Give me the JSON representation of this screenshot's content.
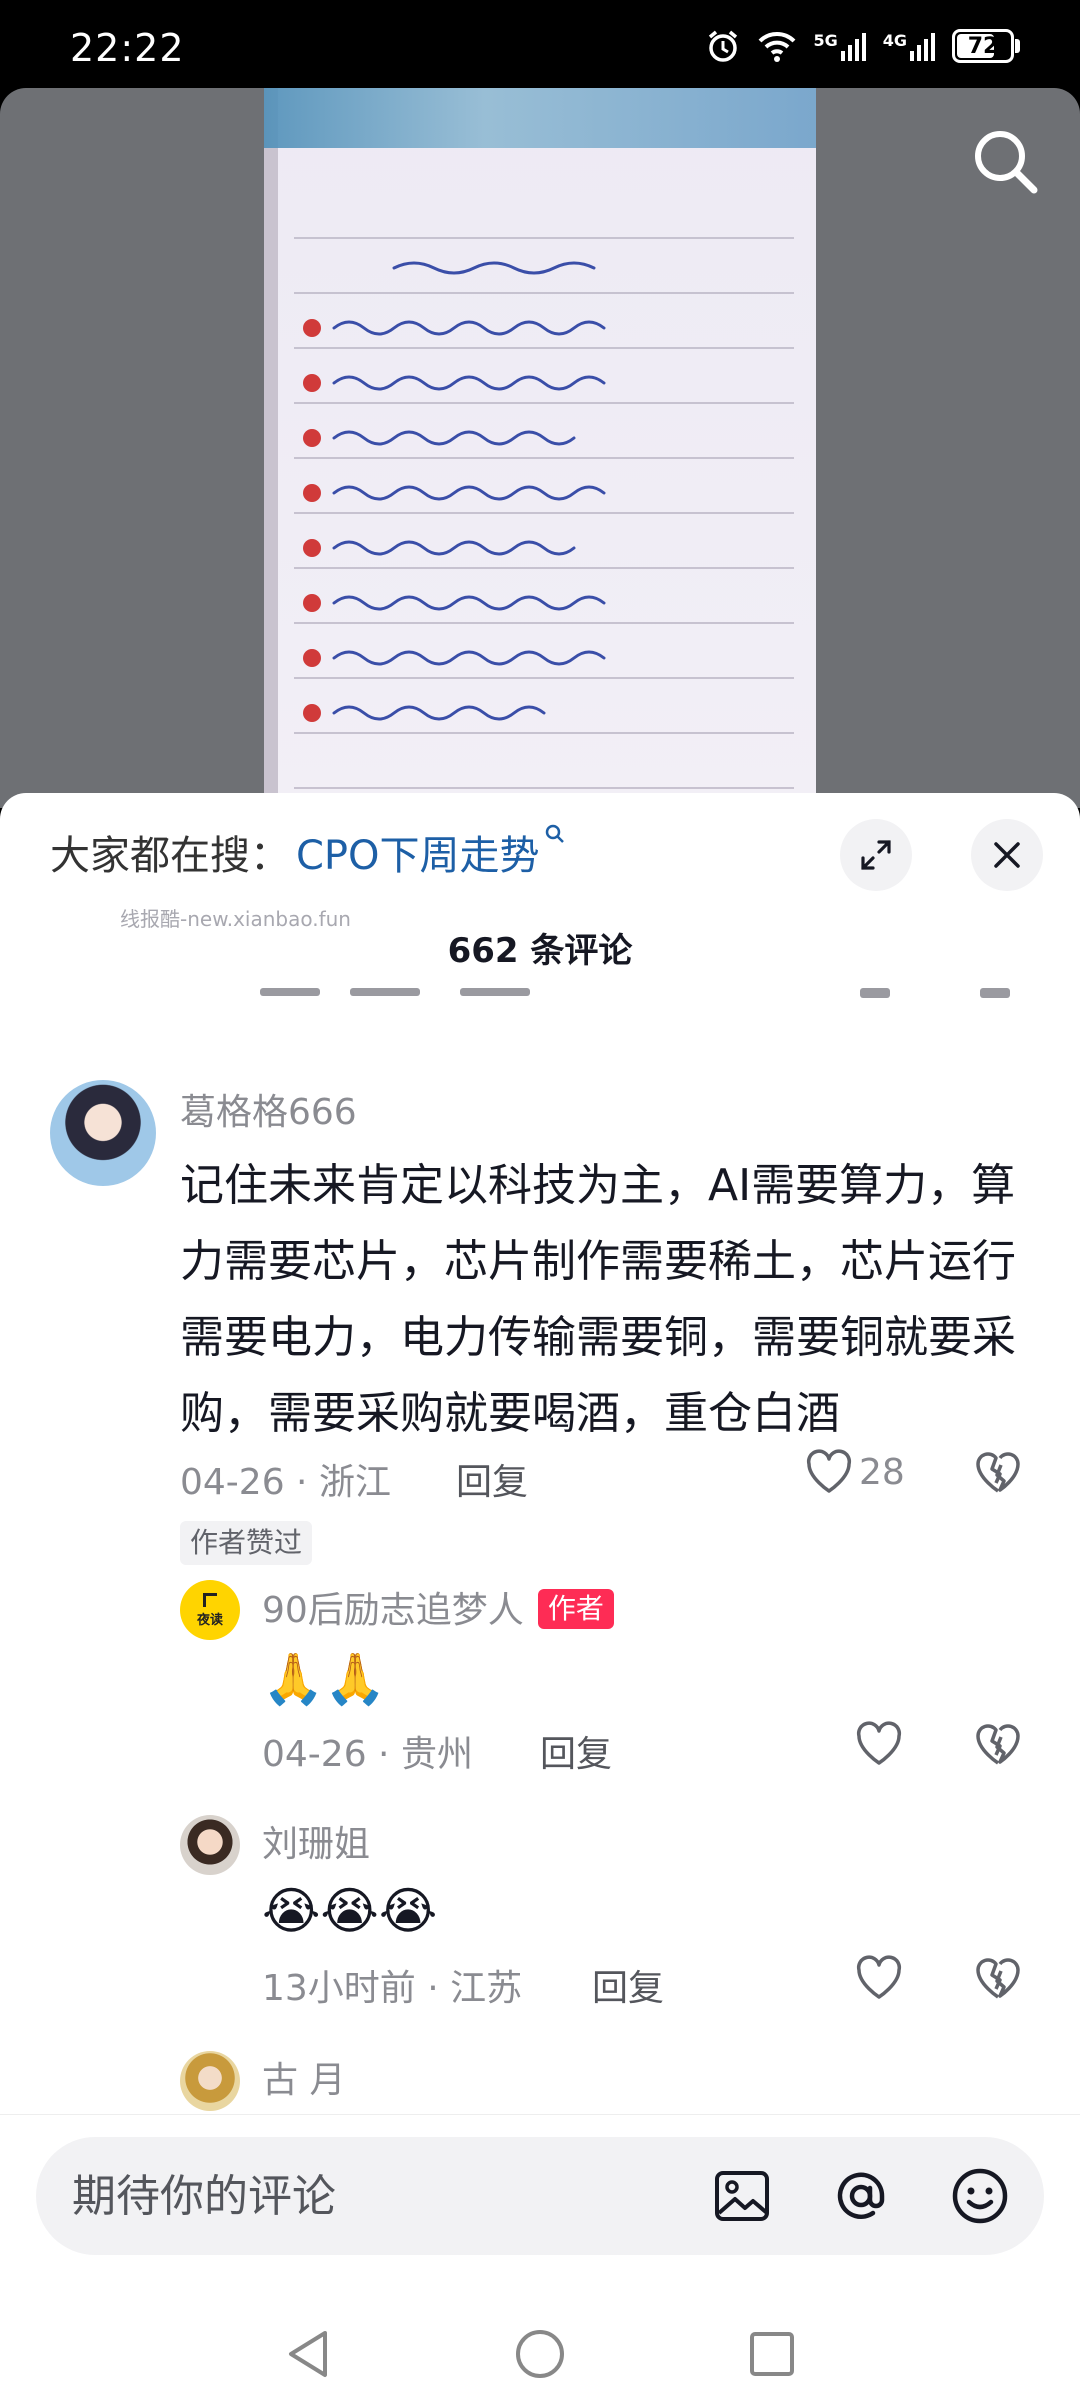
{
  "status_bar": {
    "time": "22:22",
    "net1": "5G",
    "net2": "4G",
    "battery": "72",
    "battery_level": 0.72
  },
  "trending": {
    "prefix": "大家都在搜：",
    "query": "CPO下周走势"
  },
  "watermark": "线报酷-new.xianbao.fun",
  "comment_count": "662 条评论",
  "comments": [
    {
      "user": "葛格格666",
      "text": "记住未来肯定以科技为主，AI需要算力，算力需要芯片，芯片制作需要稀土，芯片运行需要电力，电力传输需要铜，需要铜就要采购，需要采购就要喝酒，重仓白酒",
      "date": "04-26",
      "location": "浙江",
      "reply_label": "回复",
      "likes": "28",
      "tag": "作者赞过"
    }
  ],
  "replies": [
    {
      "user": "90后励志追梦人",
      "badge": "作者",
      "emoji": "🙏🙏",
      "date": "04-26",
      "location": "贵州",
      "reply_label": "回复"
    },
    {
      "user": "刘珊姐",
      "emoji": "😭😭😭",
      "date": "13小时前",
      "location": "江苏",
      "reply_label": "回复"
    },
    {
      "user": "古 月"
    }
  ],
  "input": {
    "placeholder": "期待你的评论"
  },
  "colors": {
    "author_badge": "#fe2c55",
    "trend_query": "#1d5fa6"
  },
  "icons": {
    "search": "search-icon",
    "expand": "expand-icon",
    "close": "close-icon",
    "like": "heart-icon",
    "dislike": "broken-heart-icon",
    "image": "image-icon",
    "mention": "at-icon",
    "emoji": "emoji-icon",
    "back": "back-icon",
    "home": "home-icon",
    "recents": "recents-icon"
  }
}
